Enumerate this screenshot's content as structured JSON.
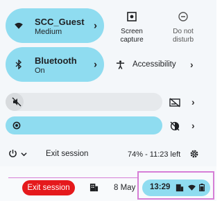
{
  "wifi": {
    "name": "SCC_Guest",
    "strength": "Medium"
  },
  "bluetooth": {
    "label": "Bluetooth",
    "state": "On"
  },
  "screen_capture": {
    "line1": "Screen",
    "line2": "capture"
  },
  "do_not_disturb": {
    "line1": "Do not",
    "line2": "disturb"
  },
  "accessibility": {
    "label": "Accessibility"
  },
  "volume": {
    "level_percent": 0
  },
  "brightness": {
    "level_percent": 100
  },
  "footer": {
    "exit_label": "Exit session",
    "battery": "74% - 11:23 left"
  },
  "shelf": {
    "exit_label": "Exit session",
    "date": "8 May",
    "time": "13:29"
  },
  "colors": {
    "tile": "#8fdcf0",
    "exit": "#e5191c",
    "highlight": "#d67ed6"
  }
}
